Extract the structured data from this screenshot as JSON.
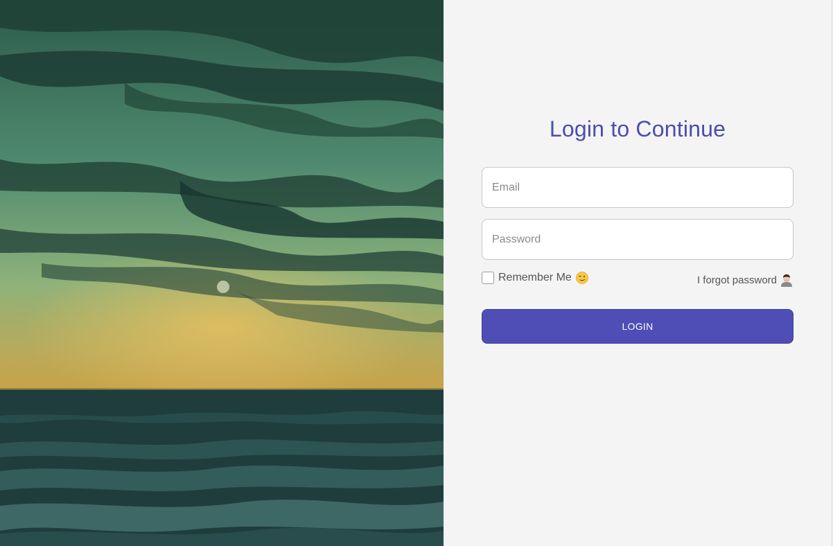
{
  "hero": {
    "image": "sunset-ocean-clouds"
  },
  "login": {
    "title": "Login to Continue",
    "email_placeholder": "Email",
    "password_placeholder": "Password",
    "remember_label": "Remember Me",
    "forgot_label": "I forgot password",
    "button_label": "LOGIN"
  },
  "icons": {
    "remember": "winking-face-icon",
    "forgot": "person-facepalming-icon"
  },
  "colors": {
    "accent": "#4e4eb6",
    "title": "#4c4cb0",
    "panel_background": "#f4f4f4"
  }
}
